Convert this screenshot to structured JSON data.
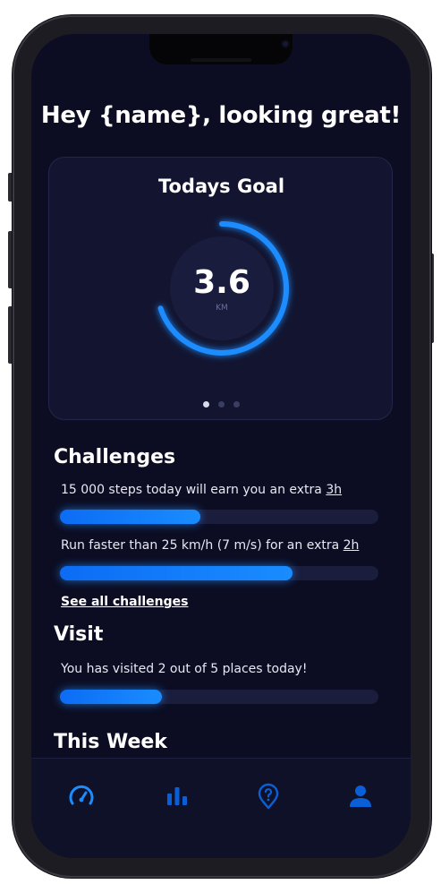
{
  "header": {
    "greeting": "Hey {name}, looking great!"
  },
  "goal_card": {
    "title": "Todays Goal",
    "value": "3.6",
    "unit": "KM",
    "progress": 0.7,
    "pages": 3,
    "active_page": 1
  },
  "challenges": {
    "title": "Challenges",
    "items": [
      {
        "text": "15 000 steps today will earn you an extra ",
        "reward": "3h",
        "progress": 0.44
      },
      {
        "text": "Run faster than 25 km/h (7 m/s) for an extra ",
        "reward": "2h",
        "progress": 0.73
      }
    ],
    "see_all_label": "See all challenges"
  },
  "visit": {
    "title": "Visit",
    "text": "You has visited 2 out of 5 places today!",
    "progress": 0.32
  },
  "this_week": {
    "title": "This Week"
  },
  "nav": {
    "items": [
      {
        "icon": "speedometer-icon",
        "active": true
      },
      {
        "icon": "bar-chart-icon",
        "active": false
      },
      {
        "icon": "location-help-icon",
        "active": false
      },
      {
        "icon": "user-icon",
        "active": false
      }
    ]
  },
  "colors": {
    "accent": "#1a8cff",
    "accent_dim": "#0a5fd6",
    "background": "#0c0d22",
    "card": "#13142f",
    "track": "#1b1d3c"
  }
}
